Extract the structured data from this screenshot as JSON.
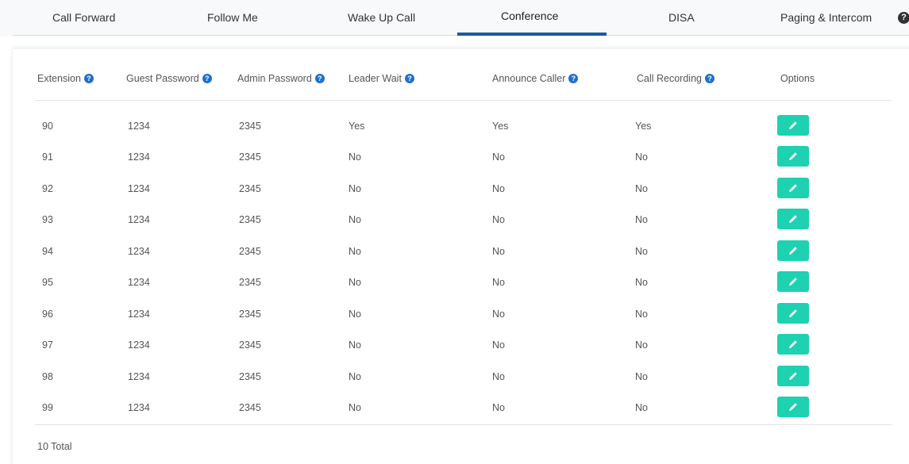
{
  "tabs": [
    {
      "label": "Call Forward",
      "active": false
    },
    {
      "label": "Follow Me",
      "active": false
    },
    {
      "label": "Wake Up Call",
      "active": false
    },
    {
      "label": "Conference",
      "active": true
    },
    {
      "label": "DISA",
      "active": false
    },
    {
      "label": "Paging & Intercom",
      "active": false
    }
  ],
  "tab_overflow_icon": "more-icon",
  "table": {
    "columns": [
      {
        "label": "Extension",
        "help": true
      },
      {
        "label": "Guest Password",
        "help": true
      },
      {
        "label": "Admin Password",
        "help": true
      },
      {
        "label": "Leader Wait",
        "help": true
      },
      {
        "label": "Announce Caller",
        "help": true
      },
      {
        "label": "Call Recording",
        "help": true
      },
      {
        "label": "Options",
        "help": false
      }
    ],
    "rows": [
      {
        "extension": "90",
        "guest_password": "1234",
        "admin_password": "2345",
        "leader_wait": "Yes",
        "announce_caller": "Yes",
        "call_recording": "Yes"
      },
      {
        "extension": "91",
        "guest_password": "1234",
        "admin_password": "2345",
        "leader_wait": "No",
        "announce_caller": "No",
        "call_recording": "No"
      },
      {
        "extension": "92",
        "guest_password": "1234",
        "admin_password": "2345",
        "leader_wait": "No",
        "announce_caller": "No",
        "call_recording": "No"
      },
      {
        "extension": "93",
        "guest_password": "1234",
        "admin_password": "2345",
        "leader_wait": "No",
        "announce_caller": "No",
        "call_recording": "No"
      },
      {
        "extension": "94",
        "guest_password": "1234",
        "admin_password": "2345",
        "leader_wait": "No",
        "announce_caller": "No",
        "call_recording": "No"
      },
      {
        "extension": "95",
        "guest_password": "1234",
        "admin_password": "2345",
        "leader_wait": "No",
        "announce_caller": "No",
        "call_recording": "No"
      },
      {
        "extension": "96",
        "guest_password": "1234",
        "admin_password": "2345",
        "leader_wait": "No",
        "announce_caller": "No",
        "call_recording": "No"
      },
      {
        "extension": "97",
        "guest_password": "1234",
        "admin_password": "2345",
        "leader_wait": "No",
        "announce_caller": "No",
        "call_recording": "No"
      },
      {
        "extension": "98",
        "guest_password": "1234",
        "admin_password": "2345",
        "leader_wait": "No",
        "announce_caller": "No",
        "call_recording": "No"
      },
      {
        "extension": "99",
        "guest_password": "1234",
        "admin_password": "2345",
        "leader_wait": "No",
        "announce_caller": "No",
        "call_recording": "No"
      }
    ],
    "row_action_icon": "edit-pencil-icon",
    "total": "10 Total"
  },
  "colors": {
    "accent": "#1a5aa0",
    "edit_button": "#1dd1b1",
    "help_icon": "#1f6fd1"
  }
}
